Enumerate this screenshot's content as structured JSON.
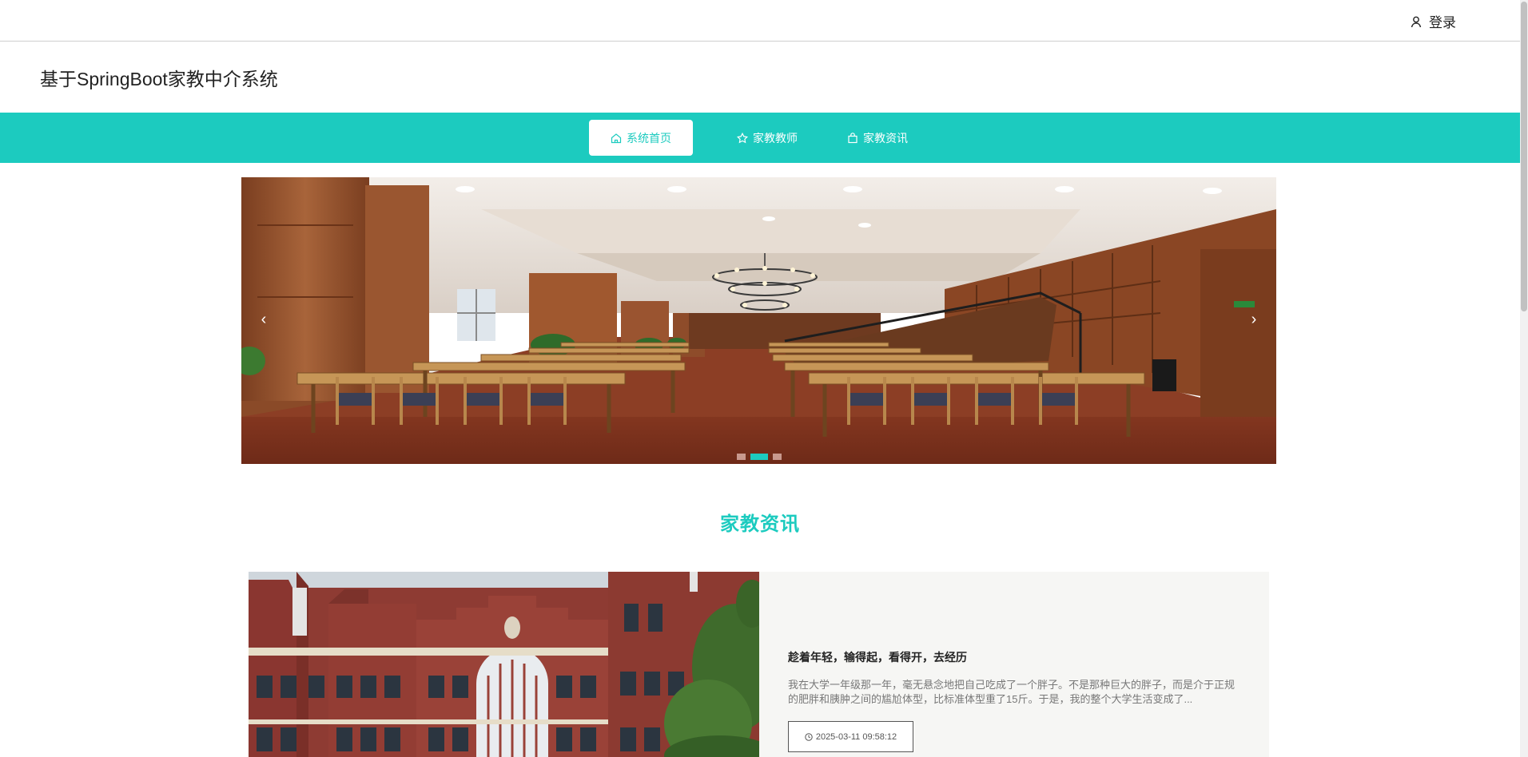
{
  "topbar": {
    "login_label": "登录",
    "login_icon": "user-icon"
  },
  "header": {
    "site_title": "基于SpringBoot家教中介系统"
  },
  "nav": {
    "items": [
      {
        "label": "系统首页",
        "icon": "home-icon",
        "active": true
      },
      {
        "label": "家教教师",
        "icon": "star-icon",
        "active": false
      },
      {
        "label": "家教资讯",
        "icon": "bag-icon",
        "active": false
      }
    ]
  },
  "carousel": {
    "arrow_left": "‹",
    "arrow_right": "›",
    "slide_count": 3,
    "active_slide": 2
  },
  "news_section": {
    "title": "家教资讯",
    "items": [
      {
        "title": "趁着年轻，输得起，看得开，去经历",
        "description": "我在大学一年级那一年，毫无悬念地把自己吃成了一个胖子。不是那种巨大的胖子，而是介于正规的肥胖和胰肿之间的尴尬体型，比标准体型重了15斤。于是，我的整个大学生活变成了...",
        "date": "2025-03-11 09:58:12"
      }
    ]
  },
  "colors": {
    "accent": "#1ccbbf",
    "card_bg": "#f6f6f4"
  }
}
